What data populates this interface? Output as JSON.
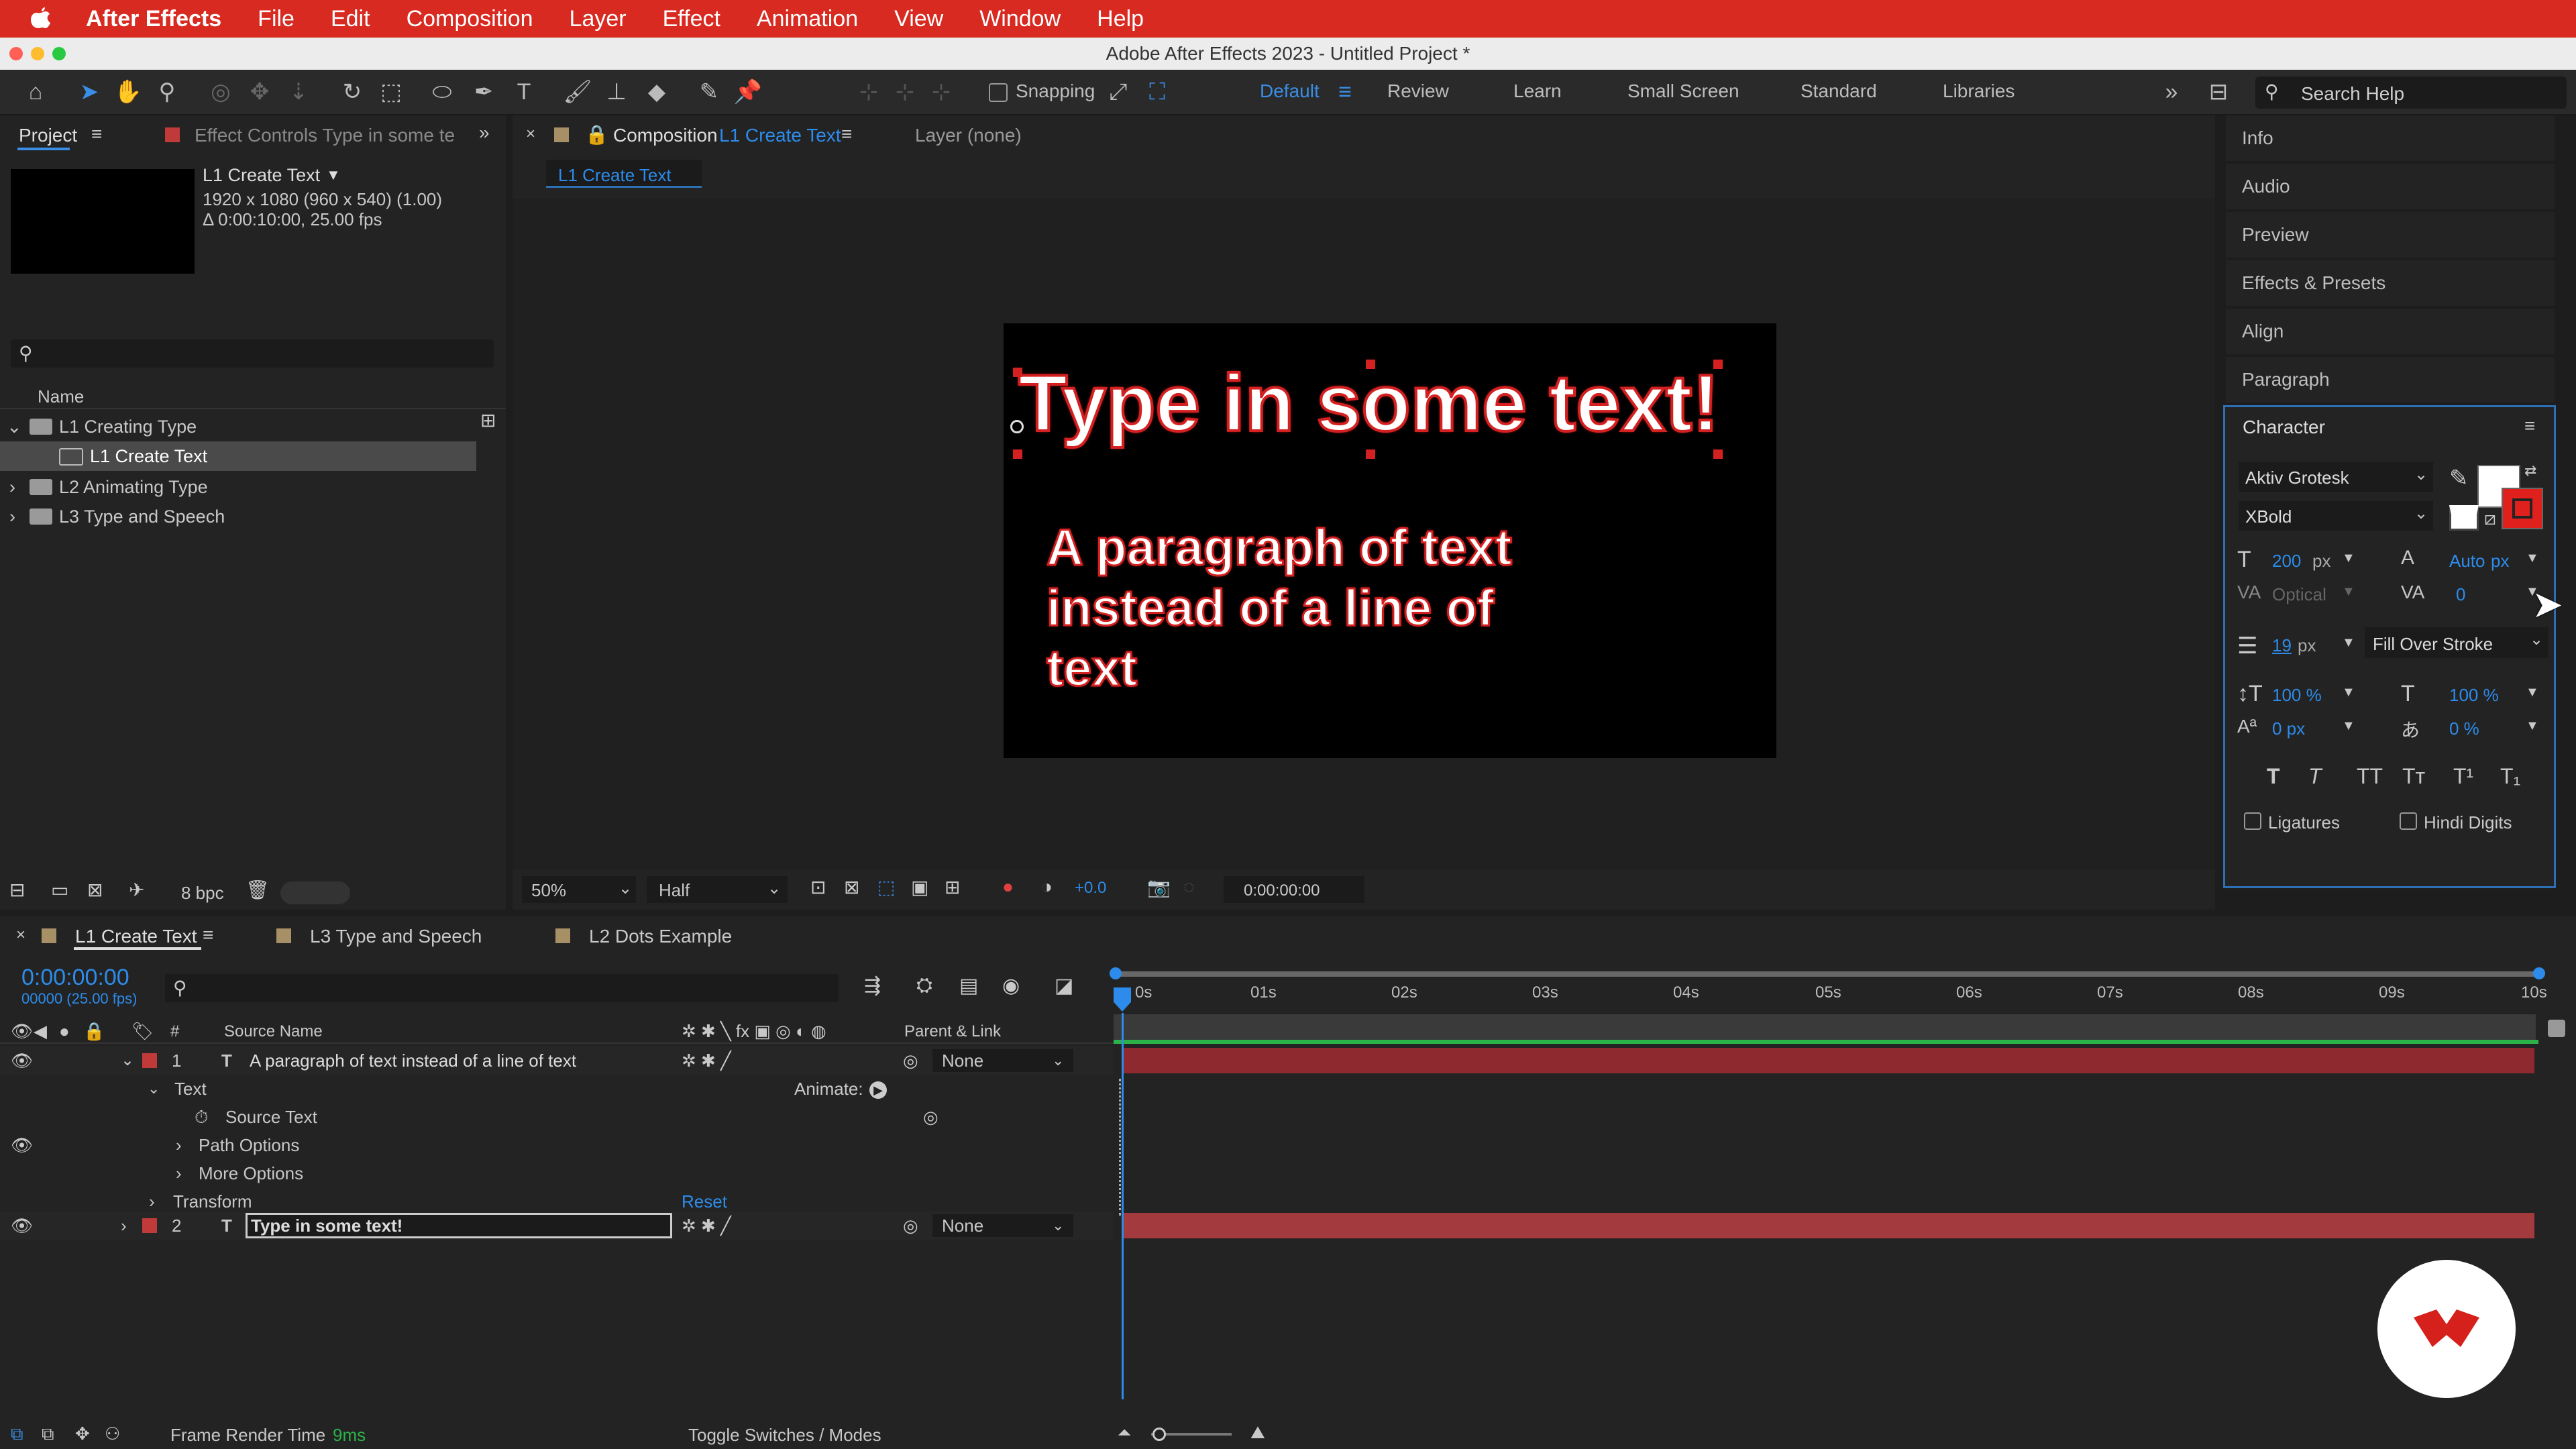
{
  "menubar": {
    "apple": "",
    "app": "After Effects",
    "items": [
      "File",
      "Edit",
      "Composition",
      "Layer",
      "Effect",
      "Animation",
      "View",
      "Window",
      "Help"
    ]
  },
  "title": "Adobe After Effects 2023 - Untitled Project *",
  "toolbar": {
    "snapping": "Snapping",
    "workspaces": [
      "Default",
      "Review",
      "Learn",
      "Small Screen",
      "Standard",
      "Libraries"
    ],
    "search_placeholder": "Search Help"
  },
  "project": {
    "tab": "Project",
    "effect_tab": "Effect Controls Type in some te",
    "comp_name": "L1 Create Text",
    "comp_info1": "1920 x 1080  (960 x 540) (1.00)",
    "comp_info2": "Δ 0:00:10:00, 25.00 fps",
    "col_name": "Name",
    "items": [
      {
        "name": "L1 Creating Type",
        "open": true
      },
      {
        "name": "L1 Create Text",
        "child": true
      },
      {
        "name": "L2 Animating Type"
      },
      {
        "name": "L3 Type and Speech"
      }
    ],
    "bpc": "8 bpc"
  },
  "comp": {
    "tab_label": "Composition",
    "tab_name": "L1 Create Text",
    "layer_tab": "Layer (none)",
    "subtab": "L1 Create Text",
    "title_text": "Type in some text!",
    "para_lines": [
      "A paragraph of text",
      "instead of a line of",
      "text"
    ],
    "zoom": "50%",
    "resolution": "Half",
    "exposure": "+0.0",
    "timecode": "0:00:00:00"
  },
  "side": {
    "items": [
      "Info",
      "Audio",
      "Preview",
      "Effects & Presets",
      "Align",
      "Paragraph"
    ]
  },
  "character": {
    "title": "Character",
    "font": "Aktiv Grotesk",
    "style": "XBold",
    "size": "200",
    "size_unit": "px",
    "leading": "Auto",
    "leading_unit": "px",
    "kerning": "Optical",
    "tracking": "0",
    "stroke_width": "19",
    "stroke_unit": "px",
    "stroke_mode": "Fill Over Stroke",
    "vscale": "100 %",
    "hscale": "100 %",
    "baseline": "0 px",
    "tsume": "0 %",
    "ligatures": "Ligatures",
    "hindi": "Hindi Digits",
    "fill_color": "#ffffff",
    "stroke_color": "#e0201c"
  },
  "timeline": {
    "tabs": [
      "L1 Create Text",
      "L3 Type and Speech",
      "L2 Dots Example"
    ],
    "timecode": "0:00:00:00",
    "frames": "00000 (25.00 fps)",
    "col_hash": "#",
    "col_source": "Source Name",
    "col_parent": "Parent & Link",
    "ticks": [
      "0s",
      "01s",
      "02s",
      "03s",
      "04s",
      "05s",
      "06s",
      "07s",
      "08s",
      "09s",
      "10s"
    ],
    "layers": [
      {
        "num": "1",
        "name": "A paragraph of text instead of a line of text",
        "parent": "None"
      },
      {
        "num": "2",
        "name": "Type in some text!",
        "parent": "None"
      }
    ],
    "props": {
      "text": "Text",
      "animate": "Animate:",
      "source_text": "Source Text",
      "path_options": "Path Options",
      "more_options": "More Options",
      "transform": "Transform",
      "reset": "Reset"
    },
    "frame_render_label": "Frame Render Time",
    "frame_render_value": "9ms",
    "toggle": "Toggle Switches / Modes"
  }
}
